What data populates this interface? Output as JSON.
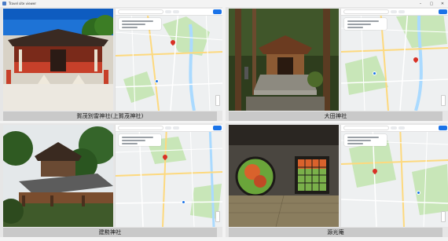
{
  "window": {
    "title": "Travel site viewer",
    "controls": [
      "–",
      "▢",
      "✕"
    ]
  },
  "panels": [
    {
      "caption": "賀茂別雷神社(上賀茂神社)",
      "photo": "shrine-gate-photo"
    },
    {
      "caption": "大田神社",
      "photo": "forest-shrine-photo"
    },
    {
      "caption": "建勲神社",
      "photo": "hillside-shrine-photo"
    },
    {
      "caption": "源光庵",
      "photo": "temple-window-photo"
    }
  ],
  "colors": {
    "map_water": "#aadaff",
    "map_green": "#c8e6b8",
    "map_road": "#ffffff",
    "map_major_road": "#fdd97e",
    "accent": "#1a73e8"
  }
}
